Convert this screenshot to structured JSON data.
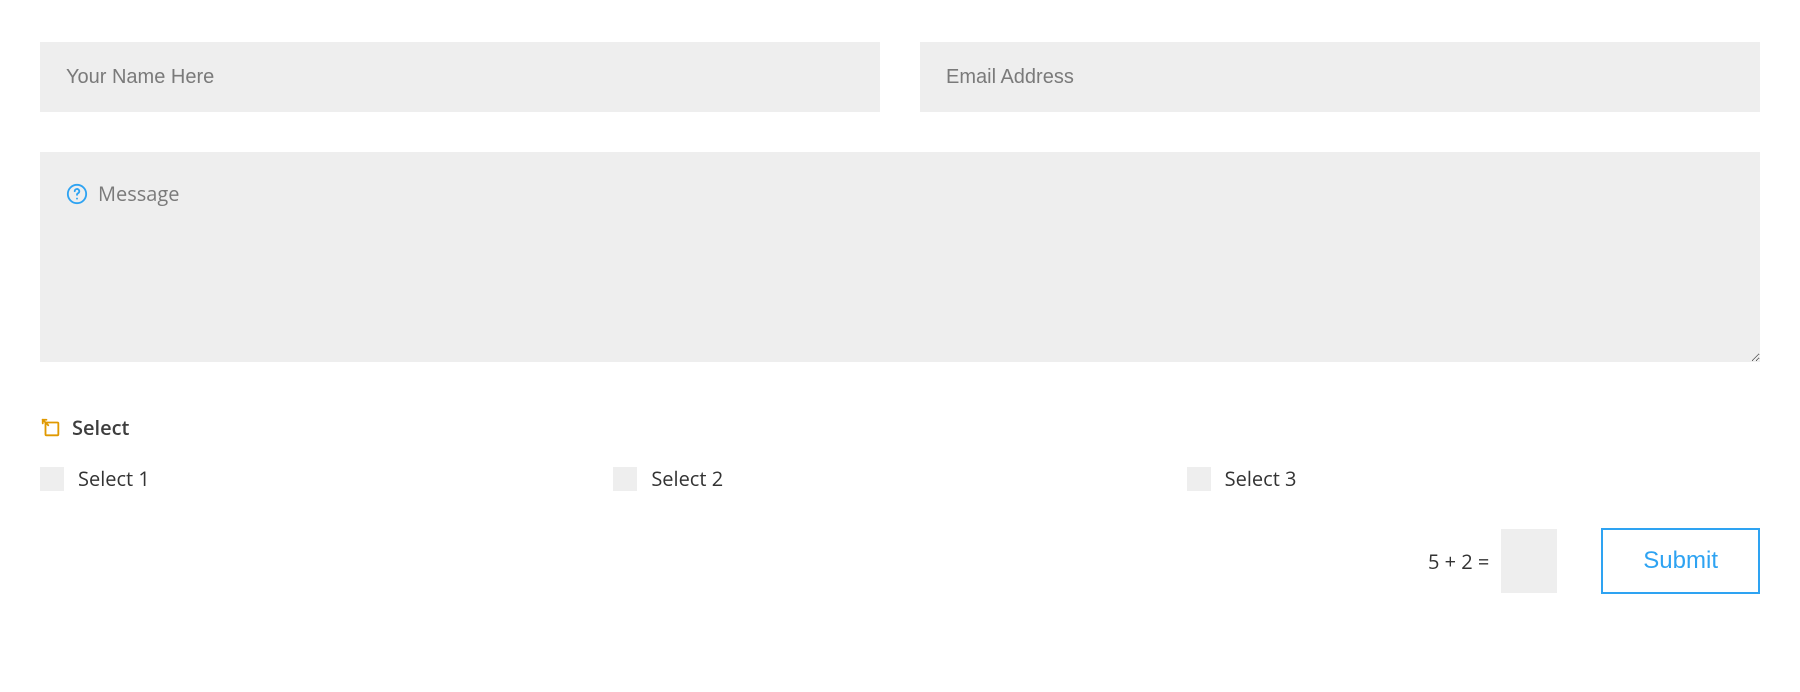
{
  "fields": {
    "name_placeholder": "Your Name Here",
    "email_placeholder": "Email Address",
    "message_placeholder": "Message"
  },
  "select": {
    "title": "Select",
    "options": [
      "Select 1",
      "Select 2",
      "Select 3"
    ]
  },
  "captcha": {
    "question": "5 + 2 ="
  },
  "submit_label": "Submit",
  "colors": {
    "accent": "#2ea3f2",
    "select_icon": "#e09900",
    "field_bg": "#eeeeee"
  }
}
